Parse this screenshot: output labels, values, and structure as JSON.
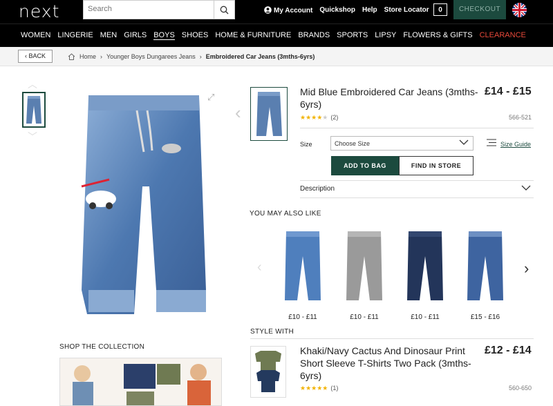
{
  "header": {
    "logo": "next",
    "search_placeholder": "Search",
    "links": [
      "My Account",
      "Quickshop",
      "Help",
      "Store Locator"
    ],
    "bag_count": "0",
    "checkout_label": "CHECKOUT"
  },
  "nav": {
    "items": [
      "WOMEN",
      "LINGERIE",
      "MEN",
      "GIRLS",
      "BOYS",
      "SHOES",
      "HOME & FURNITURE",
      "BRANDS",
      "SPORTS",
      "LIPSY",
      "FLOWERS & GIFTS",
      "CLEARANCE"
    ],
    "active": "BOYS"
  },
  "breadcrumb": {
    "back_label": "BACK",
    "items": [
      "Home",
      "Younger Boys Dungarees Jeans",
      "Embroidered Car Jeans (3mths-6yrs)"
    ]
  },
  "product": {
    "title": "Mid Blue Embroidered Car Jeans (3mths-6yrs)",
    "price": "£14 - £15",
    "rating_count": "(2)",
    "code": "566-521",
    "size_label": "Size",
    "size_select": "Choose Size",
    "size_guide": "Size Guide",
    "add_to_bag": "ADD TO BAG",
    "find_in_store": "FIND IN STORE",
    "description_label": "Description"
  },
  "also_like": {
    "title": "YOU MAY ALSO LIKE",
    "items": [
      {
        "price": "£10 - £11"
      },
      {
        "price": "£10 - £11"
      },
      {
        "price": "£10 - £11"
      },
      {
        "price": "£15 - £16"
      }
    ]
  },
  "style_with": {
    "title": "STYLE WITH",
    "product_title": "Khaki/Navy Cactus And Dinosaur Print Short Sleeve T-Shirts Two Pack (3mths-6yrs)",
    "price": "£12 - £14",
    "rating_count": "(1)",
    "code": "560-650"
  },
  "collection": {
    "title": "SHOP THE COLLECTION"
  },
  "colors": {
    "brand_green": "#1c4a3e",
    "clearance": "#e8493a",
    "star": "#f2b300"
  }
}
